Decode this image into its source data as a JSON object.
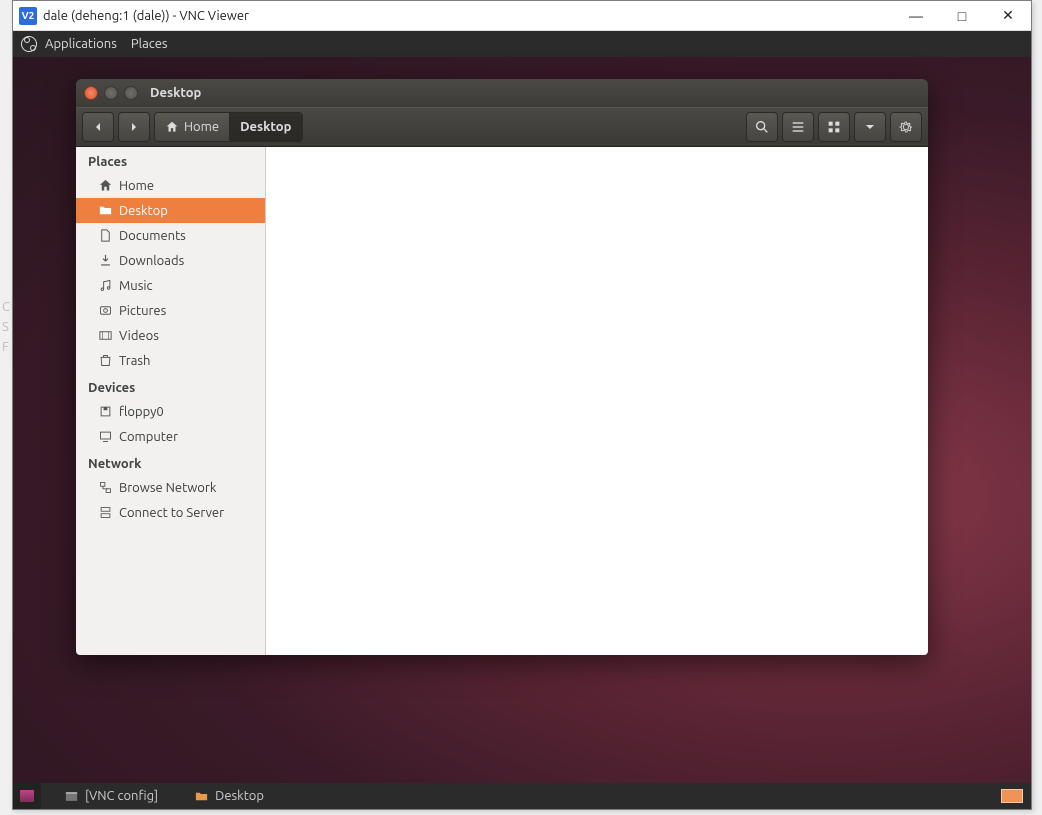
{
  "vnc": {
    "icon_text": "V2",
    "title": "dale (deheng:1 (dale)) - VNC Viewer"
  },
  "gnome_menu": {
    "applications": "Applications",
    "places": "Places"
  },
  "nautilus": {
    "title": "Desktop",
    "breadcrumb": {
      "home": "Home",
      "desktop": "Desktop"
    },
    "sidebar": {
      "places_header": "Places",
      "places": {
        "home": "Home",
        "desktop": "Desktop",
        "documents": "Documents",
        "downloads": "Downloads",
        "music": "Music",
        "pictures": "Pictures",
        "videos": "Videos",
        "trash": "Trash"
      },
      "devices_header": "Devices",
      "devices": {
        "floppy0": "floppy0",
        "computer": "Computer"
      },
      "network_header": "Network",
      "network": {
        "browse": "Browse Network",
        "connect": "Connect to Server"
      }
    }
  },
  "taskbar": {
    "vnc_config": "[VNC config]",
    "desktop": "Desktop"
  }
}
